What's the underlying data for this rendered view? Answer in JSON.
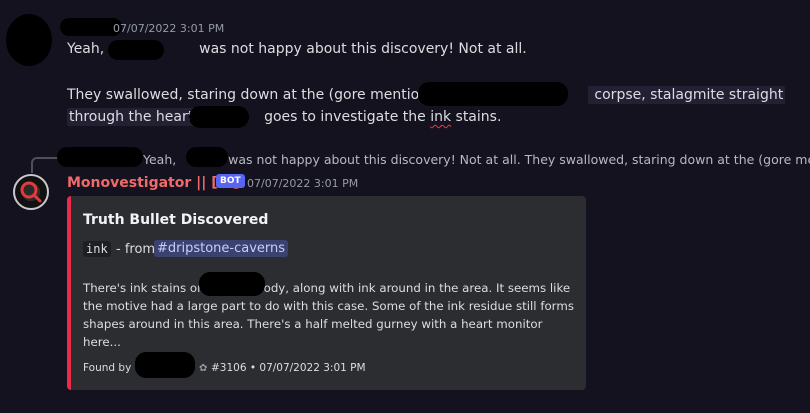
{
  "message_top": {
    "timestamp": "07/07/2022 3:01 PM",
    "line1_a": "Yeah, ",
    "line1_b": " was not happy about this discovery! Not at all.",
    "line2_a": "They swallowed, staring down at the (gore mention) ",
    "line2_b": " corpse, stalagmite straight",
    "line3_a": "through the heart.",
    "line3_b": " goes to investigate the ",
    "line3_typo": "ink",
    "line3_c": " stains."
  },
  "reply_preview": {
    "text_a": "Yeah, ",
    "text_b": " was not happy about this discovery! Not at all. They swallowed, staring down at the (gore men"
  },
  "bot_message": {
    "author": "Monovestigator || [v!]",
    "badge": "BOT",
    "timestamp": "07/07/2022 3:01 PM",
    "embed": {
      "accent_color": "#ec2a4a",
      "title": "Truth Bullet Discovered",
      "code": "ink",
      "from_label": "- from",
      "channel": "#dripstone-caverns",
      "description_a": "There's ink stains on ",
      "description_b": " body, along with ink around in the area. It seems like the motive had a large part to do with this case. Some of the ink residue still forms shapes around in this area. There's a half melted gurney with a heart monitor here...",
      "footer_label": "Found by",
      "footer_icon": "emoji-icon",
      "footer_text": "#3106 • 07/07/2022 3:01 PM"
    }
  },
  "colors": {
    "background": "#15121f",
    "author": "#f06a6a",
    "badge": "#5865f2"
  }
}
